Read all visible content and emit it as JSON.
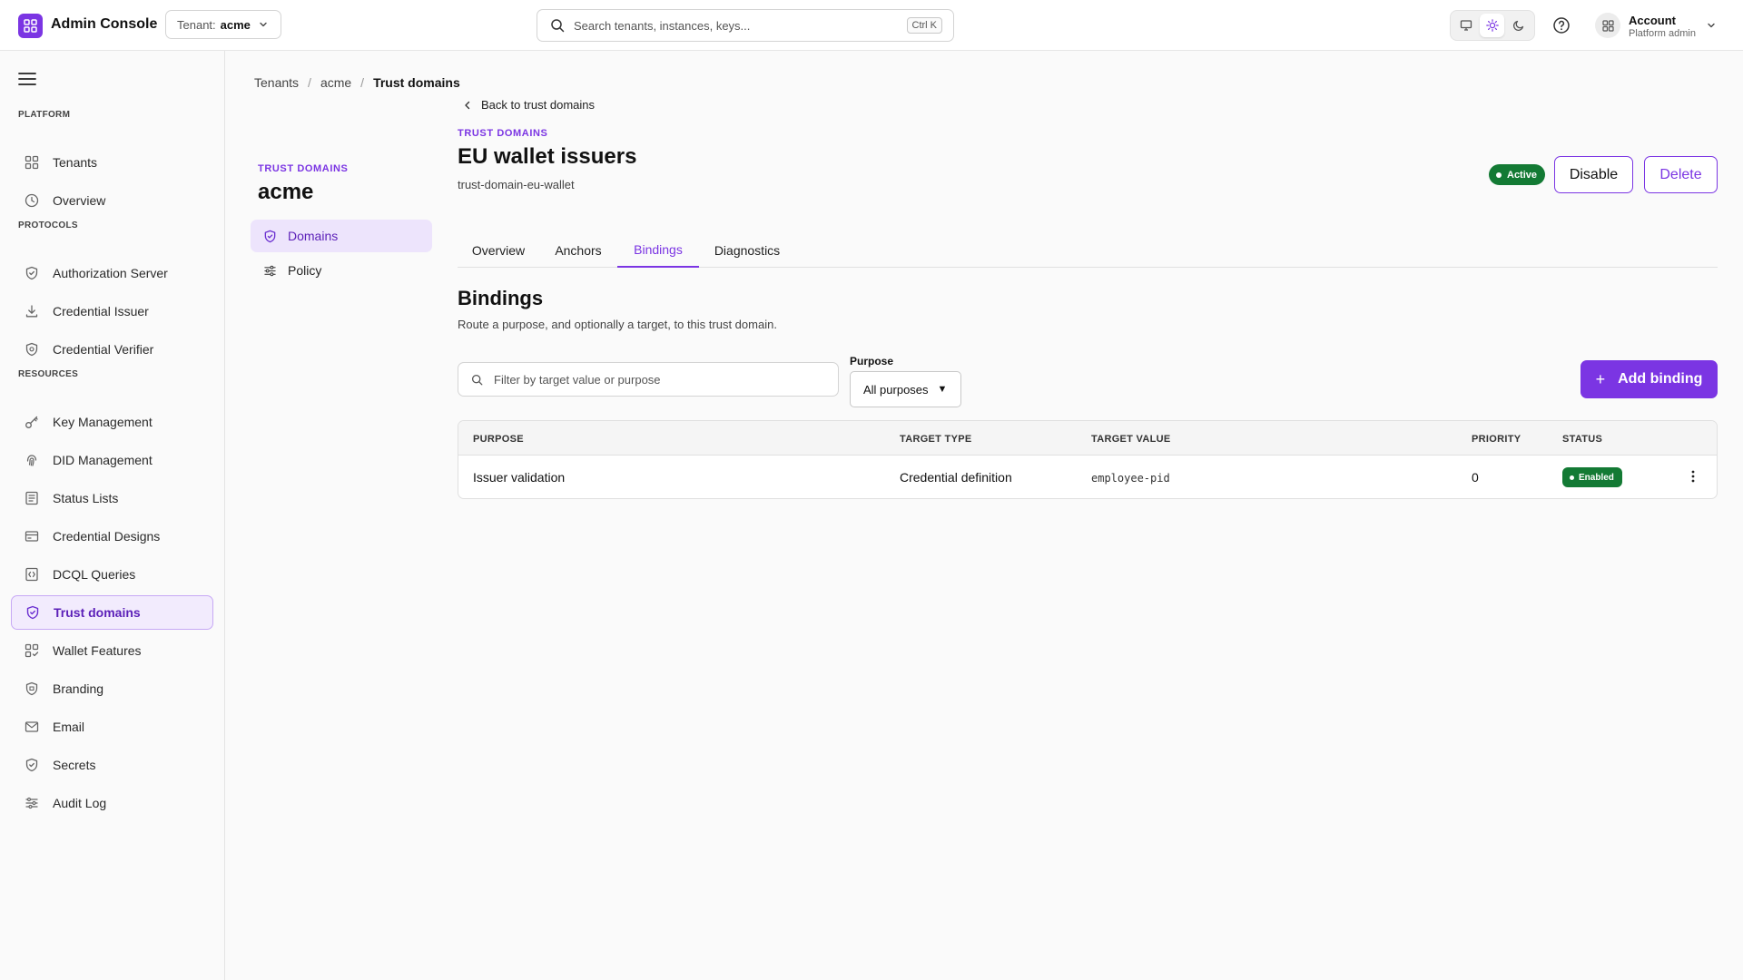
{
  "app": {
    "title": "Admin Console",
    "tenant_label": "Tenant:",
    "tenant_value": "acme",
    "search_placeholder": "Search tenants, instances, keys...",
    "search_shortcut": "Ctrl K",
    "account_name": "Account",
    "account_role": "Platform admin",
    "accent_color": "#7b35e3",
    "theme_selected": "light"
  },
  "sidebar": {
    "sections": [
      {
        "label": "PLATFORM",
        "items": [
          {
            "label": "Tenants",
            "icon": "grid-icon"
          },
          {
            "label": "Overview",
            "icon": "clock-icon"
          }
        ]
      },
      {
        "label": "PROTOCOLS",
        "items": [
          {
            "label": "Authorization Server",
            "icon": "shield-icon"
          },
          {
            "label": "Credential Issuer",
            "icon": "download-icon"
          },
          {
            "label": "Credential Verifier",
            "icon": "shield-check-icon"
          }
        ]
      },
      {
        "label": "RESOURCES",
        "items": [
          {
            "label": "Key Management",
            "icon": "key-icon"
          },
          {
            "label": "DID Management",
            "icon": "fingerprint-icon"
          },
          {
            "label": "Status Lists",
            "icon": "list-icon"
          },
          {
            "label": "Credential Designs",
            "icon": "card-icon"
          },
          {
            "label": "DCQL Queries",
            "icon": "query-icon"
          },
          {
            "label": "Trust domains",
            "icon": "shield-check-icon",
            "active": true
          },
          {
            "label": "Wallet Features",
            "icon": "grid-check-icon"
          },
          {
            "label": "Branding",
            "icon": "badge-icon"
          },
          {
            "label": "Email",
            "icon": "mail-icon"
          },
          {
            "label": "Secrets",
            "icon": "shield-icon"
          },
          {
            "label": "Audit Log",
            "icon": "sliders-icon"
          }
        ]
      }
    ]
  },
  "breadcrumb": [
    "Tenants",
    "acme",
    "Trust domains"
  ],
  "subnav": {
    "eyebrow": "TRUST DOMAINS",
    "title": "acme",
    "items": [
      {
        "label": "Domains",
        "icon": "shield-check-icon",
        "active": true
      },
      {
        "label": "Policy",
        "icon": "sliders-icon"
      }
    ]
  },
  "main": {
    "back_label": "Back to trust domains",
    "eyebrow": "TRUST DOMAINS",
    "title": "EU wallet issuers",
    "slug": "trust-domain-eu-wallet",
    "status": "Active",
    "disable_label": "Disable",
    "delete_label": "Delete",
    "tabs": [
      "Overview",
      "Anchors",
      "Bindings",
      "Diagnostics"
    ],
    "active_tab": "Bindings",
    "section_title": "Bindings",
    "section_desc": "Route a purpose, and optionally a target, to this trust domain.",
    "filter_placeholder": "Filter by target value or purpose",
    "purpose_label": "Purpose",
    "purpose_value": "All purposes",
    "add_label": "Add binding",
    "table": {
      "columns": [
        "PURPOSE",
        "TARGET TYPE",
        "TARGET VALUE",
        "PRIORITY",
        "STATUS"
      ],
      "rows": [
        {
          "purpose": "Issuer validation",
          "target_type": "Credential definition",
          "target_value": "employee-pid",
          "priority": "0",
          "status": "Enabled"
        }
      ]
    }
  }
}
